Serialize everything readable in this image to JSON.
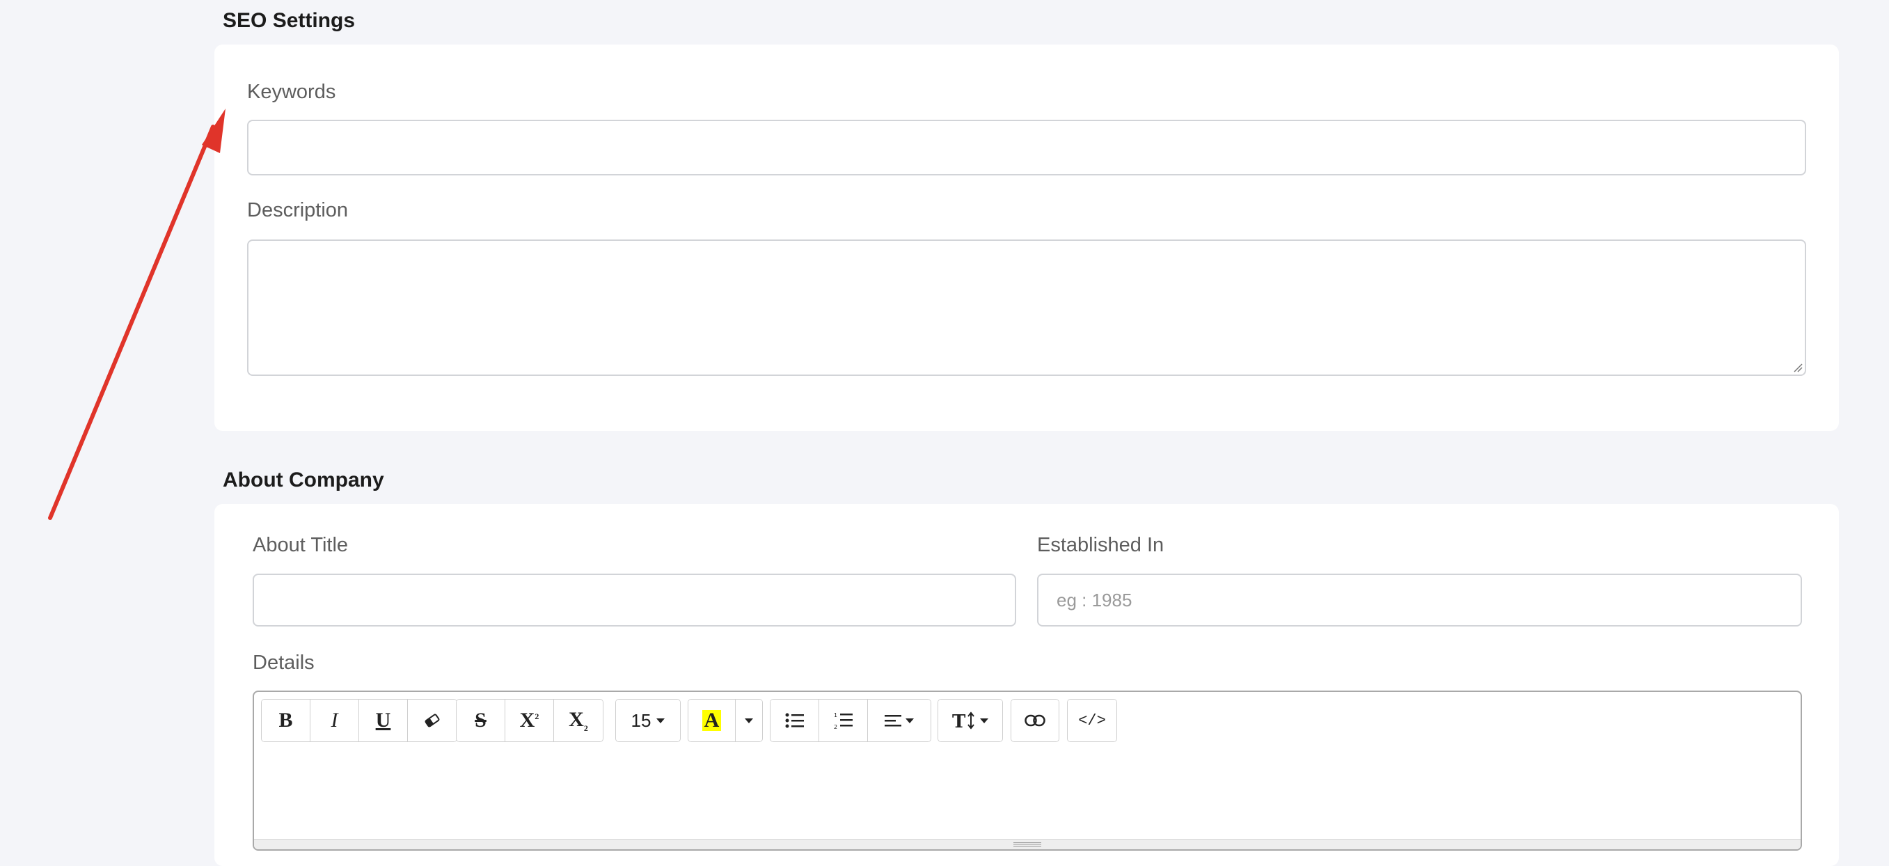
{
  "seo": {
    "title": "SEO Settings",
    "keywords_label": "Keywords",
    "keywords_value": "",
    "description_label": "Description",
    "description_value": ""
  },
  "about": {
    "title": "About Company",
    "about_title_label": "About Title",
    "about_title_value": "",
    "established_label": "Established In",
    "established_placeholder": "eg : 1985",
    "details_label": "Details"
  },
  "toolbar": {
    "font_size": "15",
    "code_view_label": "</>"
  },
  "annotation": {
    "arrow_color": "#e0342a"
  }
}
